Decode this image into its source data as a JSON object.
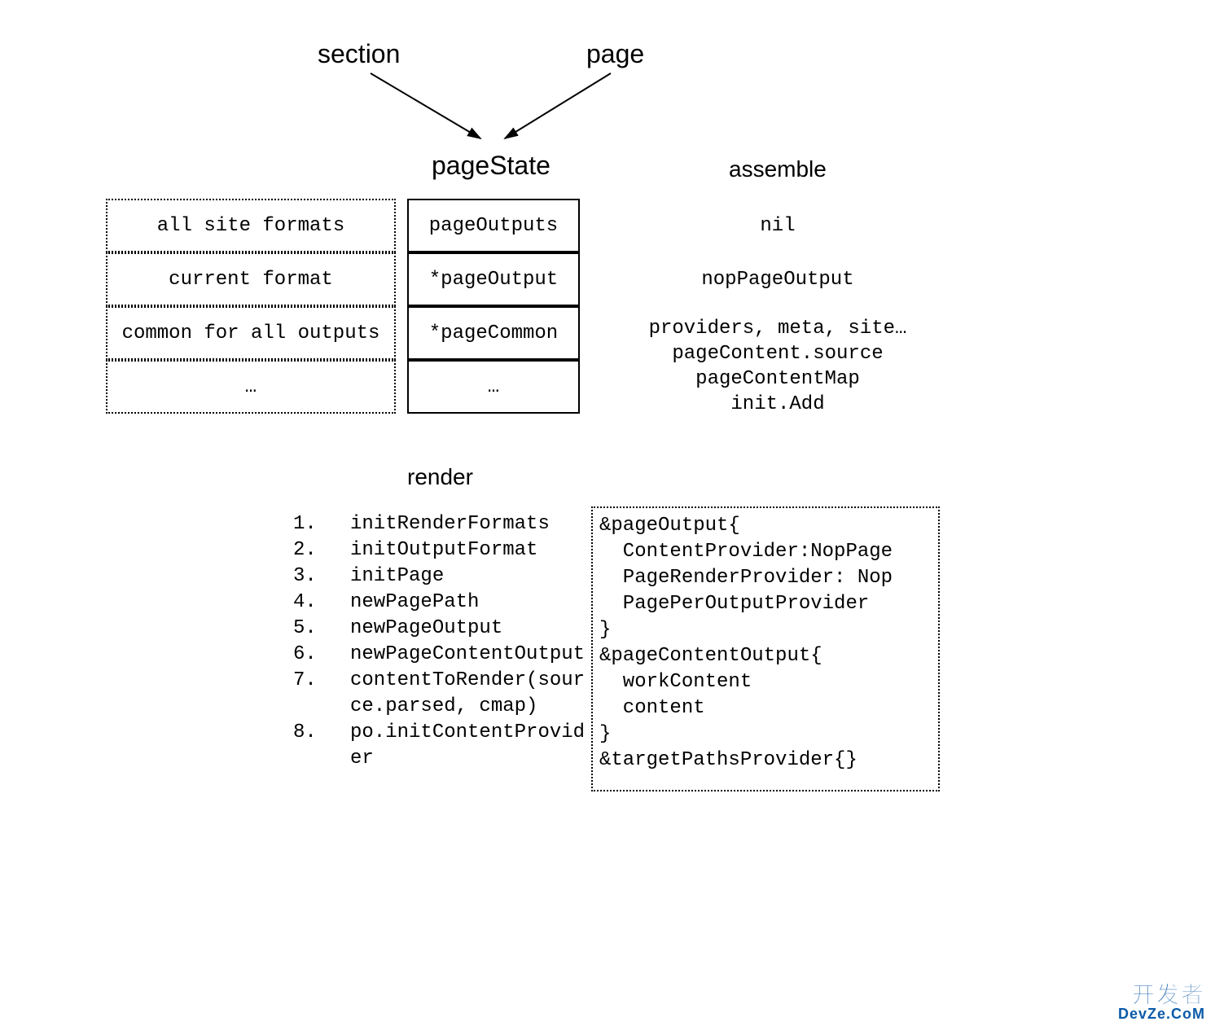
{
  "top": {
    "section": "section",
    "page": "page"
  },
  "pageState": {
    "heading": "pageState",
    "left": [
      "all site formats",
      "current format",
      "common for all outputs",
      "…"
    ],
    "mid": [
      "pageOutputs",
      "*pageOutput",
      "*pageCommon",
      "…"
    ]
  },
  "assemble": {
    "heading": "assemble",
    "rows": [
      "nil",
      "nopPageOutput",
      "providers, meta, site…",
      "pageContent.source",
      "pageContentMap",
      "init.Add"
    ]
  },
  "render": {
    "heading": "render",
    "steps": [
      "initRenderFormats",
      "initOutputFormat",
      "initPage",
      "newPagePath",
      "newPageOutput",
      "newPageContentOutput",
      "contentToRender(source.parsed, cmap)",
      "po.initContentProvider"
    ],
    "right_box": "&pageOutput{\n  ContentProvider:NopPage\n  PageRenderProvider: Nop\n  PagePerOutputProvider\n}\n&pageContentOutput{\n  workContent\n  content\n}\n&targetPathsProvider{}"
  },
  "watermark": {
    "cn": "开发者",
    "en": "DevZe.CoM"
  }
}
